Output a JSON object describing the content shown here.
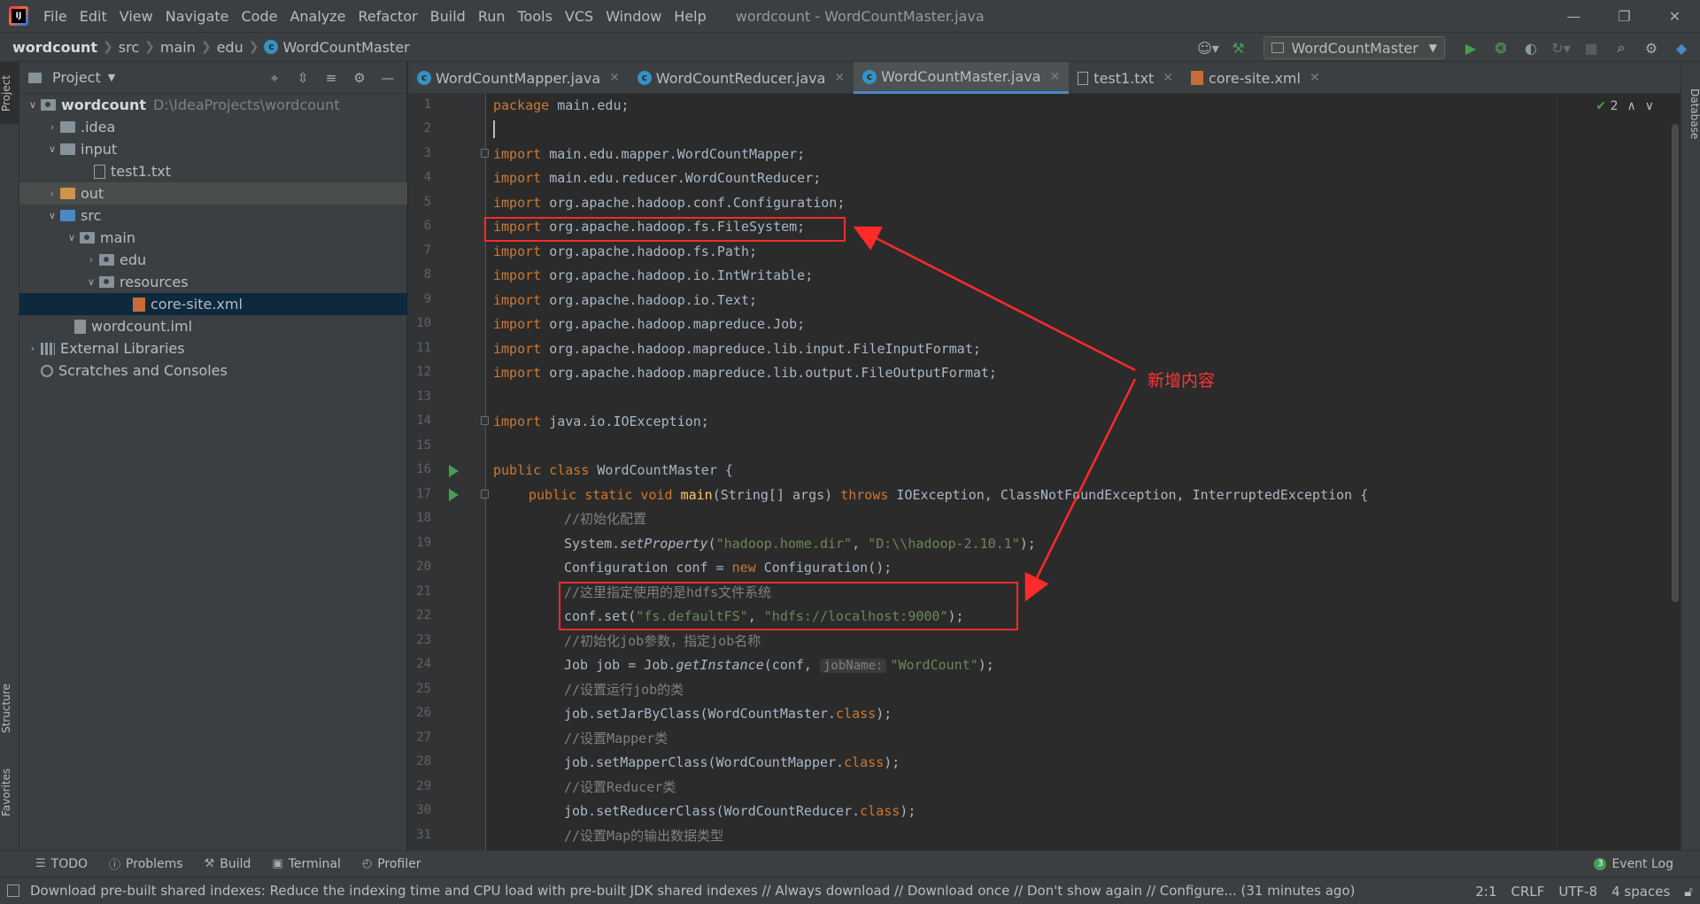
{
  "menu": {
    "items": [
      "File",
      "Edit",
      "View",
      "Navigate",
      "Code",
      "Analyze",
      "Refactor",
      "Build",
      "Run",
      "Tools",
      "VCS",
      "Window",
      "Help"
    ],
    "window_title": "wordcount - WordCountMaster.java"
  },
  "breadcrumb": {
    "project": "wordcount",
    "parts": [
      "src",
      "main",
      "edu"
    ],
    "current": "WordCountMaster"
  },
  "toolbar": {
    "run_config": "WordCountMaster"
  },
  "project_panel": {
    "title": "Project",
    "tree": [
      {
        "label": "wordcount",
        "path": "D:\\IdeaProjects\\wordcount"
      },
      {
        "label": ".idea"
      },
      {
        "label": "input"
      },
      {
        "label": "test1.txt"
      },
      {
        "label": "out"
      },
      {
        "label": "src"
      },
      {
        "label": "main"
      },
      {
        "label": "edu"
      },
      {
        "label": "resources"
      },
      {
        "label": "core-site.xml"
      },
      {
        "label": "wordcount.iml"
      },
      {
        "label": "External Libraries"
      },
      {
        "label": "Scratches and Consoles"
      }
    ]
  },
  "side_strips": {
    "left_tabs": [
      "Project",
      "Structure",
      "Favorites"
    ],
    "right_tabs": [
      "Database"
    ]
  },
  "editor_tabs": [
    {
      "label": "WordCountMapper.java"
    },
    {
      "label": "WordCountReducer.java"
    },
    {
      "label": "WordCountMaster.java",
      "active": true
    },
    {
      "label": "test1.txt"
    },
    {
      "label": "core-site.xml"
    }
  ],
  "editor": {
    "line_numbers": [
      "1",
      "2",
      "3",
      "4",
      "5",
      "6",
      "7",
      "8",
      "9",
      "10",
      "11",
      "12",
      "13",
      "14",
      "15",
      "16",
      "17",
      "18",
      "19",
      "20",
      "21",
      "22",
      "23",
      "24",
      "25",
      "26",
      "27",
      "28",
      "29",
      "30",
      "31"
    ],
    "inspection_count": "2",
    "lines": {
      "l1_kw": "package",
      "l1_rest": " main.edu;",
      "l3_kw": "import",
      "l3_rest": " main.edu.mapper.WordCountMapper;",
      "l4_kw": "import",
      "l4_rest": " main.edu.reducer.WordCountReducer;",
      "l5_kw": "import",
      "l5_rest": " org.apache.hadoop.conf.Configuration;",
      "l6_kw": "import",
      "l6_rest": " org.apache.hadoop.fs.FileSystem;",
      "l7_kw": "import",
      "l7_rest": " org.apache.hadoop.fs.Path;",
      "l8_kw": "import",
      "l8_rest": " org.apache.hadoop.io.IntWritable;",
      "l9_kw": "import",
      "l9_rest": " org.apache.hadoop.io.Text;",
      "l10_kw": "import",
      "l10_rest": " org.apache.hadoop.mapreduce.Job;",
      "l11_kw": "import",
      "l11_rest": " org.apache.hadoop.mapreduce.lib.input.FileInputFormat;",
      "l12_kw": "import",
      "l12_rest": " org.apache.hadoop.mapreduce.lib.output.FileOutputFormat;",
      "l14_kw": "import",
      "l14_rest": " java.io.IOException;",
      "l16_kw": "public class",
      "l16_rest": " WordCountMaster {",
      "l17_kw1": "public static void",
      "l17_fn": "main",
      "l17_a": "(String[] args) ",
      "l17_kw2": "throws",
      "l17_b": " IOException, ClassNotFoundException, InterruptedException {",
      "l18_cm": "//初始化配置",
      "l19_a": "System.",
      "l19_it": "setProperty",
      "l19_b": "(",
      "l19_s1": "\"hadoop.home.dir\"",
      "l19_c": ", ",
      "l19_s2": "\"D:\\\\hadoop-2.10.1\"",
      "l19_d": ");",
      "l20_a": "Configuration conf = ",
      "l20_kw": "new",
      "l20_b": " Configuration();",
      "l21_cm": "//这里指定使用的是hdfs文件系统",
      "l22_a": "conf.set(",
      "l22_s1": "\"fs.defaultFS\"",
      "l22_b": ", ",
      "l22_s2": "\"hdfs://localhost:9000\"",
      "l22_c": ");",
      "l23_cm": "//初始化job参数，指定job名称",
      "l24_a": "Job job = Job.",
      "l24_it": "getInstance",
      "l24_b": "(conf, ",
      "l24_hint": "jobName:",
      "l24_s": "\"WordCount\"",
      "l24_c": ");",
      "l25_cm": "//设置运行job的类",
      "l26_a": "job.setJarByClass(WordCountMaster.",
      "l26_kw": "class",
      "l26_b": ");",
      "l27_cm": "//设置Mapper类",
      "l28_a": "job.setMapperClass(WordCountMapper.",
      "l28_kw": "class",
      "l28_b": ");",
      "l29_cm": "//设置Reducer类",
      "l30_a": "job.setReducerClass(WordCountReducer.",
      "l30_kw": "class",
      "l30_b": ");",
      "l31_cm": "//设置Map的输出数据类型"
    }
  },
  "annotation": {
    "text": "新增内容",
    "color": "#ff2a2a"
  },
  "bottom_tools": {
    "todo": "TODO",
    "problems": "Problems",
    "build": "Build",
    "terminal": "Terminal",
    "profiler": "Profiler",
    "event_log": "Event Log",
    "event_count": "3"
  },
  "status": {
    "message": "Download pre-built shared indexes: Reduce the indexing time and CPU load with pre-built JDK shared indexes // Always download // Download once // Don't show again // Configure... (31 minutes ago)",
    "position": "2:1",
    "line_sep": "CRLF",
    "encoding": "UTF-8",
    "indent": "4 spaces"
  },
  "colors": {
    "keyword": "#cc7832",
    "string": "#6a8759",
    "comment": "#808080",
    "method": "#ffc66d",
    "run_green": "#499c54",
    "selection_blue": "#0d293e"
  }
}
